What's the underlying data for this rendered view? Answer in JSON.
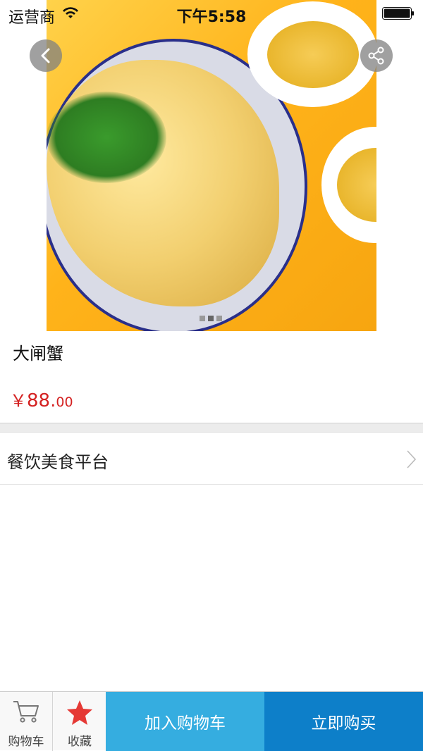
{
  "status_bar": {
    "carrier": "运营商",
    "time": "下午5:58"
  },
  "product": {
    "title": "大闸蟹",
    "price_currency": "￥",
    "price_main": "88.",
    "price_cents": "00",
    "image_icon": "food-photo",
    "carousel_total": 3,
    "carousel_active": 1
  },
  "store": {
    "name": "餐饮美食平台"
  },
  "bottom_bar": {
    "cart_label": "购物车",
    "favorite_label": "收藏",
    "add_to_cart_label": "加入购物车",
    "buy_now_label": "立即购买"
  },
  "colors": {
    "price": "#d42222",
    "add_to_cart": "#35ade0",
    "buy_now": "#0d7fc9",
    "favorite_star": "#e53935"
  },
  "icons": [
    "wifi-icon",
    "battery-icon",
    "back-icon",
    "share-icon",
    "chevron-right-icon",
    "cart-icon",
    "star-icon"
  ]
}
